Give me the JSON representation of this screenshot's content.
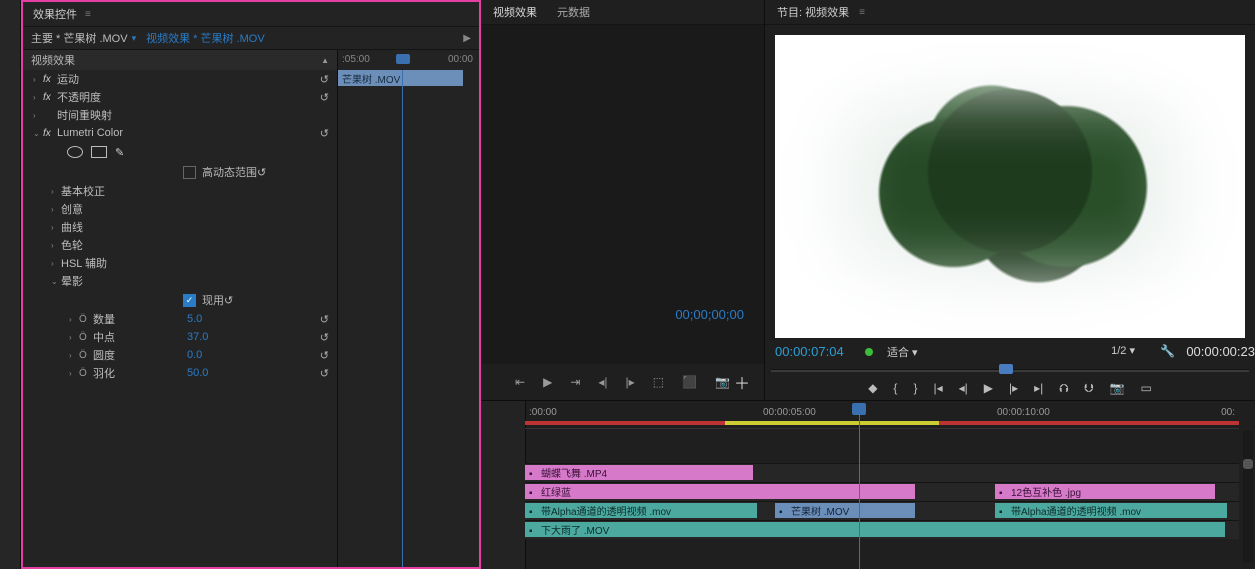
{
  "effect_controls": {
    "panel_title": "效果控件",
    "master_label": "主要 * 芒果树 .MOV",
    "clip_crumb": "视频效果 * 芒果树 .MOV",
    "section_title": "视频效果",
    "motion": "运动",
    "opacity": "不透明度",
    "time_remap": "时间重映射",
    "lumetri": "Lumetri Color",
    "hdr_label": "高动态范围",
    "basic_correction": "基本校正",
    "creative": "创意",
    "curves": "曲线",
    "color_wheels": "色轮",
    "hsl_secondary": "HSL 辅助",
    "vignette": "晕影",
    "enable_label": "现用",
    "amount_label": "数量",
    "amount_val": "5.0",
    "midpoint_label": "中点",
    "midpoint_val": "37.0",
    "roundness_label": "圆度",
    "roundness_val": "0.0",
    "feather_label": "羽化",
    "feather_val": "50.0",
    "mini_tl_start": ":05:00",
    "mini_tl_end": "00:00",
    "mini_clip_label": "芒果树 .MOV"
  },
  "source_monitor": {
    "tab1": "视频效果",
    "tab2": "元数据",
    "timecode": "00;00;00;00"
  },
  "program_monitor": {
    "title": "节目: 视频效果",
    "timecode": "00:00:07:04",
    "fit_label": "适合",
    "res_label": "1/2",
    "duration": "00:00:00:23"
  },
  "timeline": {
    "t0": ":00:00",
    "t5": "00:00:05:00",
    "t10": "00:00:10:00",
    "tend": "00:",
    "clips": {
      "v3a": "蝴蝶飞舞 .MP4",
      "v2a": "红绿蓝",
      "v2b": "12色互补色 .jpg",
      "v1a": "带Alpha通道的透明视频 .mov",
      "v1b": "芒果树 .MOV",
      "v1c": "带Alpha通道的透明视频 .mov",
      "a1a": "下大雨了 .MOV"
    }
  }
}
